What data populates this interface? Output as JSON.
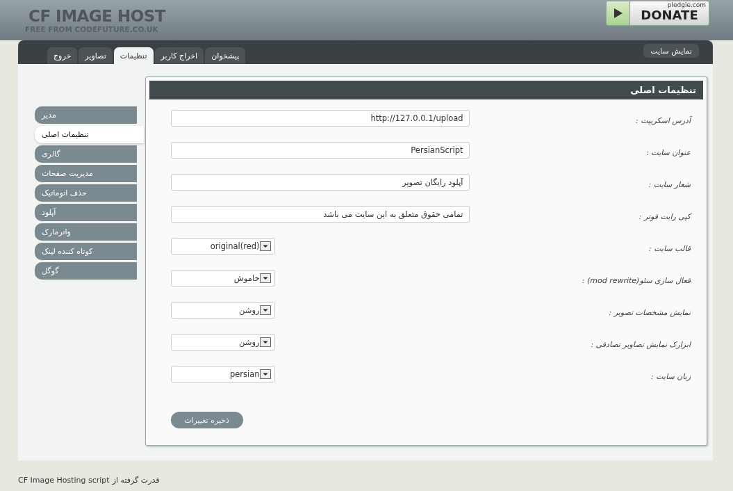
{
  "header": {
    "logo": "CF IMAGE HOST",
    "tagline": "FREE FROM CODEFUTURE.CO.UK",
    "donate": {
      "brand": "pledgie.com",
      "label": "DONATE"
    }
  },
  "tabs": [
    {
      "label": "پیشخوان",
      "selected": false
    },
    {
      "label": "اخراج کاربر",
      "selected": false
    },
    {
      "label": "تنظیمات",
      "selected": true
    },
    {
      "label": "تصاویر",
      "selected": false
    },
    {
      "label": "خروج",
      "selected": false
    }
  ],
  "site_view_button": "نمایش سایت",
  "sidebar": {
    "items": [
      {
        "label": "مدیر",
        "selected": false
      },
      {
        "label": "تنظیمات اصلی",
        "selected": true
      },
      {
        "label": "گالری",
        "selected": false
      },
      {
        "label": "مدیریت صفحات",
        "selected": false
      },
      {
        "label": "حذف اتوماتیک",
        "selected": false
      },
      {
        "label": "آپلود",
        "selected": false
      },
      {
        "label": "واترمارک",
        "selected": false
      },
      {
        "label": "کوتاه کننده لینک",
        "selected": false
      },
      {
        "label": "گوگل",
        "selected": false
      }
    ]
  },
  "panel": {
    "title": "تنظیمات اصلی",
    "fields": [
      {
        "kind": "text",
        "label": "آدرس اسکریپت :",
        "value": "http://127.0.0.1/upload"
      },
      {
        "kind": "text",
        "label": "عنوان سایت :",
        "value": "PersianScript"
      },
      {
        "kind": "text",
        "label": "شعار سایت :",
        "value": "آپلود رایگان تصویر"
      },
      {
        "kind": "text",
        "label": "کپی رایت فوتر :",
        "value": "تمامی حقوق متعلق به این سایت می باشد"
      },
      {
        "kind": "select",
        "label": "قالب سایت :",
        "value": "original(red)"
      },
      {
        "kind": "select",
        "label": "فعال سازی سئو(mod rewrite) :",
        "value": "خاموش"
      },
      {
        "kind": "select",
        "label": "نمایش مشخصات تصویر :",
        "value": "روشن"
      },
      {
        "kind": "select",
        "label": "ابزارک نمایش تصاویر تصادفی :",
        "value": "روشن"
      },
      {
        "kind": "select",
        "label": "زبان سایت :",
        "value": "persian"
      }
    ],
    "save_button": "ذخیره تغییرات"
  },
  "footer": {
    "text": "قدرت گرفته از",
    "link": "CF Image Hosting script"
  }
}
